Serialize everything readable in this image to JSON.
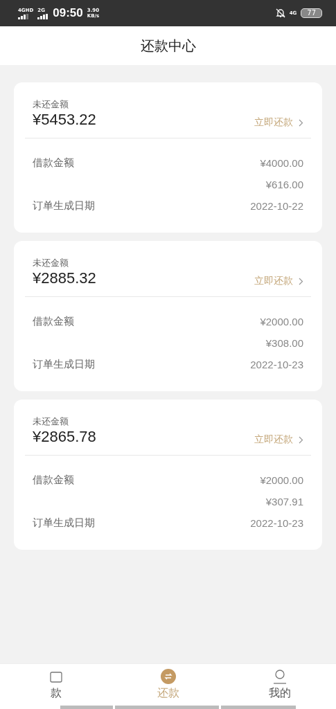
{
  "status_bar": {
    "network_1": "4GHD",
    "network_2": "2G",
    "time": "09:50",
    "speed_value": "3.90",
    "speed_unit": "KB/s",
    "network_3": "4G",
    "battery": "77"
  },
  "header": {
    "title": "还款中心"
  },
  "loans": [
    {
      "outstanding_label": "未还金额",
      "outstanding": "¥5453.22",
      "action": "立即还款",
      "rows": [
        {
          "label": "借款金额",
          "value": "¥4000.00"
        },
        {
          "label": "",
          "value": "¥616.00"
        },
        {
          "label": "订单生成日期",
          "value": "2022-10-22"
        }
      ]
    },
    {
      "outstanding_label": "未还金额",
      "outstanding": "¥2885.32",
      "action": "立即还款",
      "rows": [
        {
          "label": "借款金额",
          "value": "¥2000.00"
        },
        {
          "label": "",
          "value": "¥308.00"
        },
        {
          "label": "订单生成日期",
          "value": "2022-10-23"
        }
      ]
    },
    {
      "outstanding_label": "未还金额",
      "outstanding": "¥2865.78",
      "action": "立即还款",
      "rows": [
        {
          "label": "借款金额",
          "value": "¥2000.00"
        },
        {
          "label": "",
          "value": "¥307.91"
        },
        {
          "label": "订单生成日期",
          "value": "2022-10-23"
        }
      ]
    }
  ],
  "tab_bar": [
    {
      "label": "款",
      "kind": "loan",
      "selected": false
    },
    {
      "label": "还款",
      "kind": "repay",
      "selected": true
    },
    {
      "label": "我的",
      "kind": "me",
      "selected": false
    }
  ]
}
